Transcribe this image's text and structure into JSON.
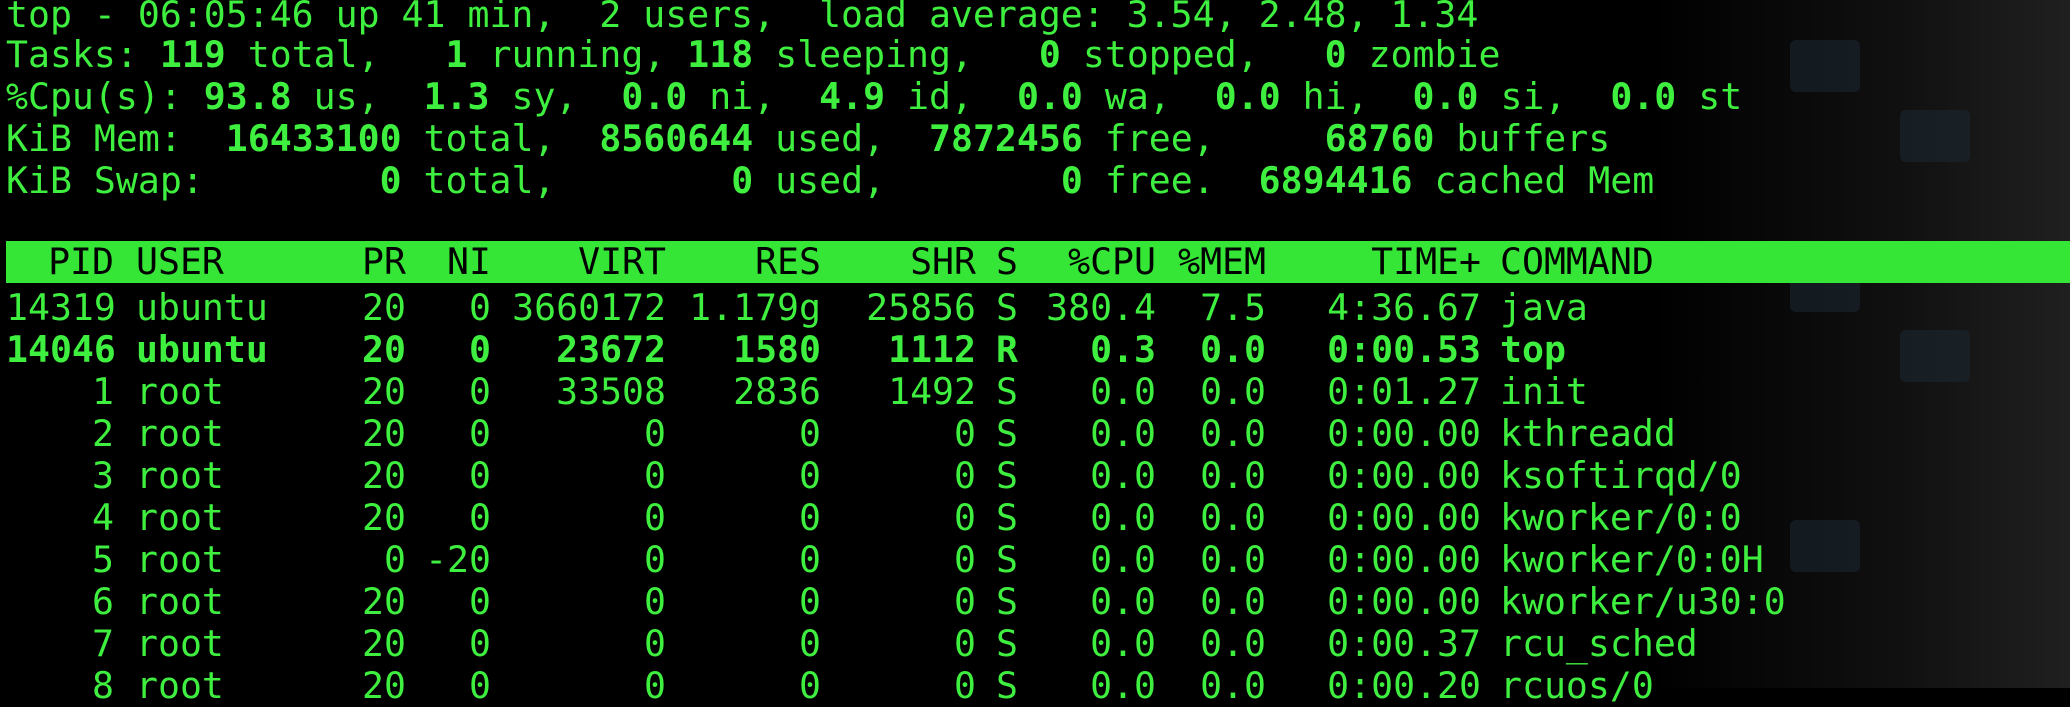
{
  "summary": {
    "line1": "top - 06:05:46 up 41 min,  2 users,  load average: 3.54, 2.48, 1.34",
    "tasks": {
      "prefix": "Tasks:",
      "total": "119",
      "total_lbl": " total,",
      "running": "1",
      "running_lbl": " running,",
      "sleeping": "118",
      "sleeping_lbl": " sleeping,",
      "stopped": "0",
      "stopped_lbl": " stopped,",
      "zombie": "0",
      "zombie_lbl": " zombie"
    },
    "cpu": {
      "prefix": "%Cpu(s):",
      "us": "93.8",
      "us_lbl": " us,",
      "sy": "1.3",
      "sy_lbl": " sy,",
      "ni": "0.0",
      "ni_lbl": " ni,",
      "id": "4.9",
      "id_lbl": " id,",
      "wa": "0.0",
      "wa_lbl": " wa,",
      "hi": "0.0",
      "hi_lbl": " hi,",
      "si": "0.0",
      "si_lbl": " si,",
      "st": "0.0",
      "st_lbl": " st"
    },
    "mem": {
      "prefix": "KiB Mem: ",
      "total": "16433100",
      "total_lbl": " total,",
      "used": "8560644",
      "used_lbl": " used,",
      "free": "7872456",
      "free_lbl": " free,",
      "buffers": "68760",
      "buffers_lbl": " buffers"
    },
    "swap": {
      "prefix": "KiB Swap:",
      "total": "0",
      "total_lbl": " total,",
      "used": "0",
      "used_lbl": " used,",
      "free": "0",
      "free_lbl": " free.",
      "cached": "6894416",
      "cached_lbl": " cached Mem"
    }
  },
  "columns": [
    "PID",
    "USER",
    "PR",
    "NI",
    "VIRT",
    "RES",
    "SHR",
    "S",
    "%CPU",
    "%MEM",
    "TIME+",
    "COMMAND"
  ],
  "processes": [
    {
      "pid": "14319",
      "user": "ubuntu",
      "pr": "20",
      "ni": "0",
      "virt": "3660172",
      "res": "1.179g",
      "shr": "25856",
      "s": "S",
      "cpu": "380.4",
      "mem": "7.5",
      "time": "4:36.67",
      "cmd": "java",
      "bold": false
    },
    {
      "pid": "14046",
      "user": "ubuntu",
      "pr": "20",
      "ni": "0",
      "virt": "23672",
      "res": "1580",
      "shr": "1112",
      "s": "R",
      "cpu": "0.3",
      "mem": "0.0",
      "time": "0:00.53",
      "cmd": "top",
      "bold": true
    },
    {
      "pid": "1",
      "user": "root",
      "pr": "20",
      "ni": "0",
      "virt": "33508",
      "res": "2836",
      "shr": "1492",
      "s": "S",
      "cpu": "0.0",
      "mem": "0.0",
      "time": "0:01.27",
      "cmd": "init",
      "bold": false
    },
    {
      "pid": "2",
      "user": "root",
      "pr": "20",
      "ni": "0",
      "virt": "0",
      "res": "0",
      "shr": "0",
      "s": "S",
      "cpu": "0.0",
      "mem": "0.0",
      "time": "0:00.00",
      "cmd": "kthreadd",
      "bold": false
    },
    {
      "pid": "3",
      "user": "root",
      "pr": "20",
      "ni": "0",
      "virt": "0",
      "res": "0",
      "shr": "0",
      "s": "S",
      "cpu": "0.0",
      "mem": "0.0",
      "time": "0:00.00",
      "cmd": "ksoftirqd/0",
      "bold": false
    },
    {
      "pid": "4",
      "user": "root",
      "pr": "20",
      "ni": "0",
      "virt": "0",
      "res": "0",
      "shr": "0",
      "s": "S",
      "cpu": "0.0",
      "mem": "0.0",
      "time": "0:00.00",
      "cmd": "kworker/0:0",
      "bold": false
    },
    {
      "pid": "5",
      "user": "root",
      "pr": "0",
      "ni": "-20",
      "virt": "0",
      "res": "0",
      "shr": "0",
      "s": "S",
      "cpu": "0.0",
      "mem": "0.0",
      "time": "0:00.00",
      "cmd": "kworker/0:0H",
      "bold": false
    },
    {
      "pid": "6",
      "user": "root",
      "pr": "20",
      "ni": "0",
      "virt": "0",
      "res": "0",
      "shr": "0",
      "s": "S",
      "cpu": "0.0",
      "mem": "0.0",
      "time": "0:00.00",
      "cmd": "kworker/u30:0",
      "bold": false
    },
    {
      "pid": "7",
      "user": "root",
      "pr": "20",
      "ni": "0",
      "virt": "0",
      "res": "0",
      "shr": "0",
      "s": "S",
      "cpu": "0.0",
      "mem": "0.0",
      "time": "0:00.37",
      "cmd": "rcu_sched",
      "bold": false
    },
    {
      "pid": "8",
      "user": "root",
      "pr": "20",
      "ni": "0",
      "virt": "0",
      "res": "0",
      "shr": "0",
      "s": "S",
      "cpu": "0.0",
      "mem": "0.0",
      "time": "0:00.20",
      "cmd": "rcuos/0",
      "bold": false
    }
  ]
}
